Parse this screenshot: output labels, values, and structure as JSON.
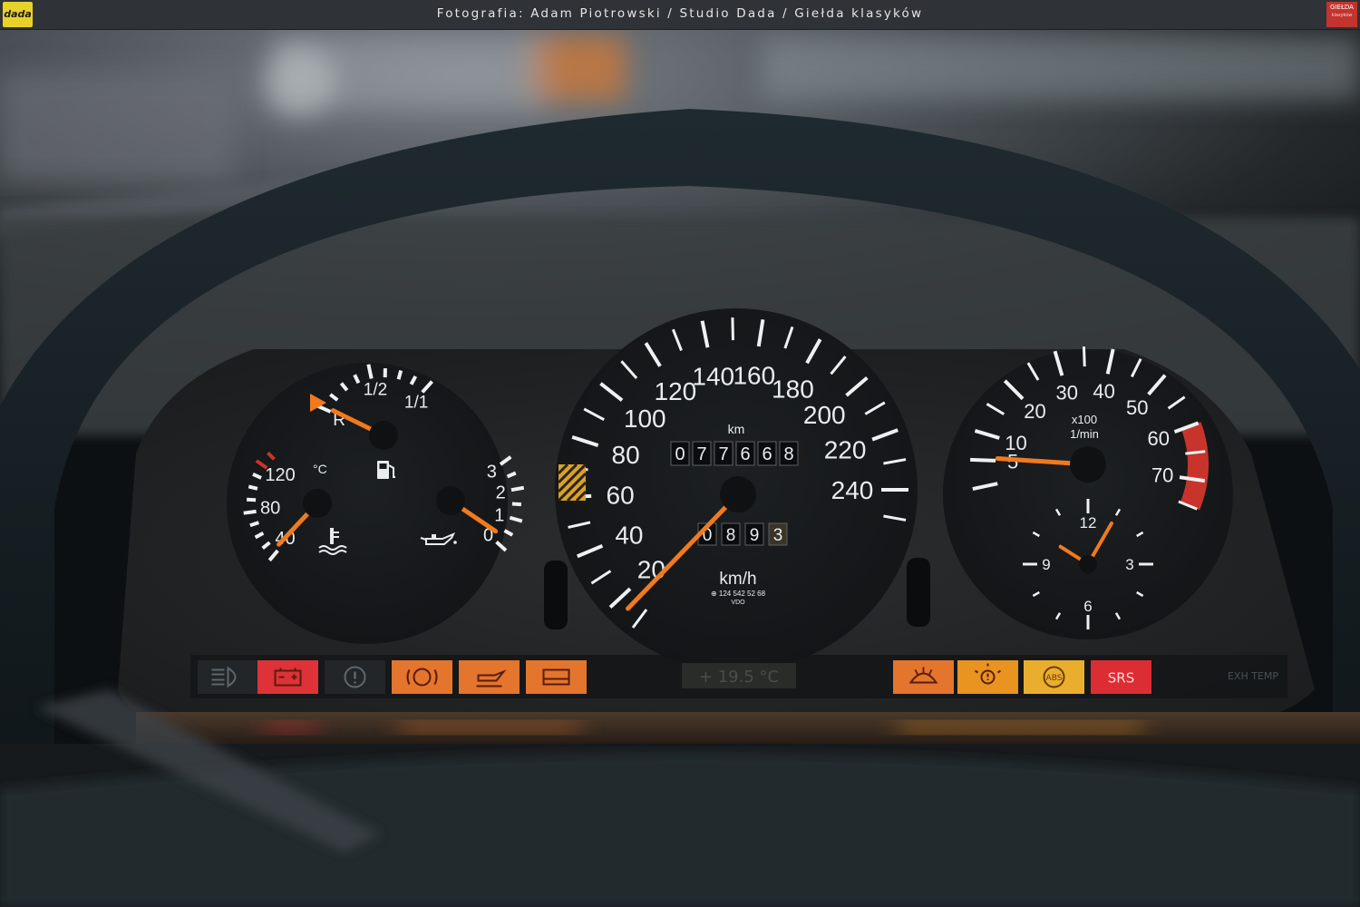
{
  "credit": {
    "text": "Fotografia: Adam Piotrowski / Studio Dada / Giełda klasyków",
    "logo_left": "dada",
    "logo_right": "GIEŁDA",
    "logo_right_sub": "klasyków"
  },
  "speedometer": {
    "labels": [
      "20",
      "40",
      "60",
      "80",
      "100",
      "120",
      "140",
      "160",
      "180",
      "200",
      "220",
      "240"
    ],
    "unit": "km/h",
    "distance_unit": "km",
    "odometer_digits": [
      "0",
      "7",
      "7",
      "6",
      "6",
      "8"
    ],
    "trip_digits": [
      "0",
      "8",
      "9",
      "3"
    ],
    "part_number": "⊕ 124 542 52 68",
    "maker": "VDO",
    "needle_speed_kmh": 17
  },
  "tachometer": {
    "labels": [
      "5",
      "10",
      "20",
      "30",
      "40",
      "50",
      "60",
      "70"
    ],
    "unit_line1": "x100",
    "unit_line2": "1/min",
    "needle_rpm_x100": 5.5,
    "redline_from_x100": 60
  },
  "clock": {
    "labels": [
      "12",
      "3",
      "6",
      "9"
    ],
    "time": "10:05"
  },
  "fuel_gauge": {
    "labels": [
      "R",
      "1/2",
      "1/1"
    ],
    "level_fraction": 0.02,
    "icon": "fuel-pump-icon"
  },
  "coolant_gauge": {
    "labels": [
      "40",
      "80",
      "120"
    ],
    "unit": "°C",
    "temperature_c": 43,
    "icon": "coolant-temperature-icon"
  },
  "oil_gauge": {
    "labels": [
      "0",
      "1",
      "2",
      "3"
    ],
    "pressure": 0.3,
    "icon": "oil-can-icon"
  },
  "outside_temperature": {
    "text": "+ 19.5 °C"
  },
  "warning_lamps": [
    {
      "id": "headlight",
      "icon": "headlight-icon",
      "color": "#2b3034",
      "lit": false
    },
    {
      "id": "battery",
      "icon": "battery-icon",
      "color": "#e8343a",
      "lit": true
    },
    {
      "id": "brake",
      "icon": "brake-warning-icon",
      "color": "#2b3034",
      "lit": false
    },
    {
      "id": "brake-pad",
      "icon": "brake-pad-icon",
      "color": "#ee7a2e",
      "lit": true
    },
    {
      "id": "oil-level",
      "icon": "oil-level-icon",
      "color": "#ee7a2e",
      "lit": true
    },
    {
      "id": "coolant-level",
      "icon": "coolant-level-icon",
      "color": "#ee7a2e",
      "lit": true
    },
    {
      "id": "washer-fluid",
      "icon": "washer-fluid-icon",
      "color": "#ee7a2e",
      "lit": true
    },
    {
      "id": "bulb-failure",
      "icon": "bulb-failure-icon",
      "color": "#f49a22",
      "lit": true
    },
    {
      "id": "abs",
      "icon": "abs-icon",
      "color": "#f6b630",
      "lit": true,
      "label": "ABS"
    },
    {
      "id": "srs",
      "icon": "srs-icon",
      "color": "#e62e35",
      "lit": true,
      "label": "SRS"
    }
  ],
  "exh_temp": {
    "text": "EXH TEMP"
  },
  "colors": {
    "needle": "#f07a1e",
    "numerals": "#eef0f2",
    "redline": "#c8342c",
    "dial_face": "#17191b"
  }
}
